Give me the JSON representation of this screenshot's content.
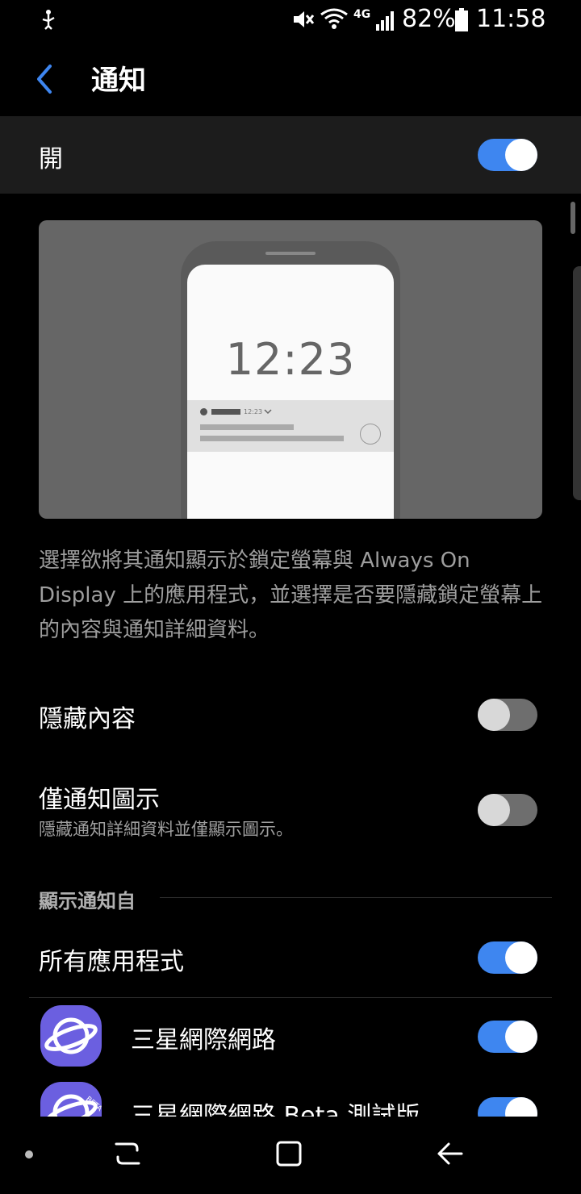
{
  "status_bar": {
    "battery_percent": "82%",
    "time": "11:58",
    "network": "4G"
  },
  "header": {
    "title": "通知"
  },
  "master": {
    "label": "開",
    "state": "on"
  },
  "preview": {
    "clock": "12:23",
    "notif_time": "12:23"
  },
  "description": "選擇欲將其通知顯示於鎖定螢幕與 Always On Display 上的應用程式，並選擇是否要隱藏鎖定螢幕上的內容與通知詳細資料。",
  "settings": {
    "hide_content": {
      "label": "隱藏內容",
      "state": "off"
    },
    "icons_only": {
      "label": "僅通知圖示",
      "sub": "隱藏通知詳細資料並僅顯示圖示。",
      "state": "off"
    }
  },
  "section": {
    "label": "顯示通知自"
  },
  "apps": {
    "all": {
      "label": "所有應用程式",
      "state": "on"
    },
    "items": [
      {
        "label": "三星網際網路",
        "state": "on",
        "icon": "samsung-internet-icon"
      },
      {
        "label": "三星網際網路 Beta 測試版",
        "state": "on",
        "icon": "samsung-internet-beta-icon",
        "badge": "BETA"
      }
    ]
  },
  "colors": {
    "accent": "#3e86f0",
    "background": "#000000",
    "app_icon": "#6b5fe0"
  }
}
